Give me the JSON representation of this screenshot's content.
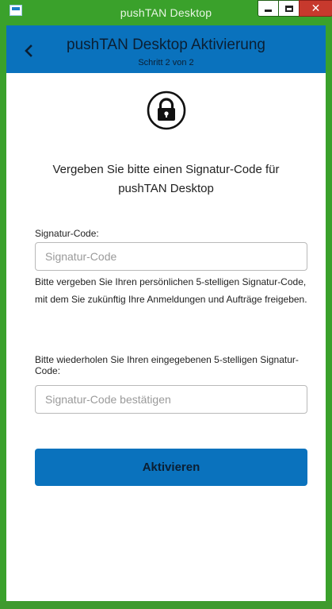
{
  "window": {
    "title": "pushTAN Desktop",
    "icons": {
      "app": "app-icon",
      "minimize": "minimize-icon",
      "maximize": "maximize-icon",
      "close": "close-icon"
    },
    "close_glyph": "✕"
  },
  "header": {
    "title": "pushTAN Desktop Aktivierung",
    "subtitle": "Schritt 2 von 2",
    "back_icon": "chevron-left-icon"
  },
  "main": {
    "lock_icon": "lock-icon",
    "intro": "Vergeben Sie bitte einen Signatur-Code für pushTAN Desktop",
    "signature_label": "Signatur-Code:",
    "signature_placeholder": "Signatur-Code",
    "signature_value": "",
    "help_text": "Bitte vergeben Sie Ihren persönlichen 5-stelligen Signatur-Code, mit dem Sie zukünftig Ihre Anmeldungen und Aufträge freigeben.",
    "repeat_label": "Bitte wiederholen Sie Ihren eingegebenen 5-stelligen Signatur-Code:",
    "repeat_placeholder": "Signatur-Code bestätigen",
    "repeat_value": "",
    "activate_label": "Aktivieren"
  },
  "colors": {
    "accent": "#0a72bd",
    "window_frame": "#3aa12b",
    "close_button": "#c7392d"
  }
}
